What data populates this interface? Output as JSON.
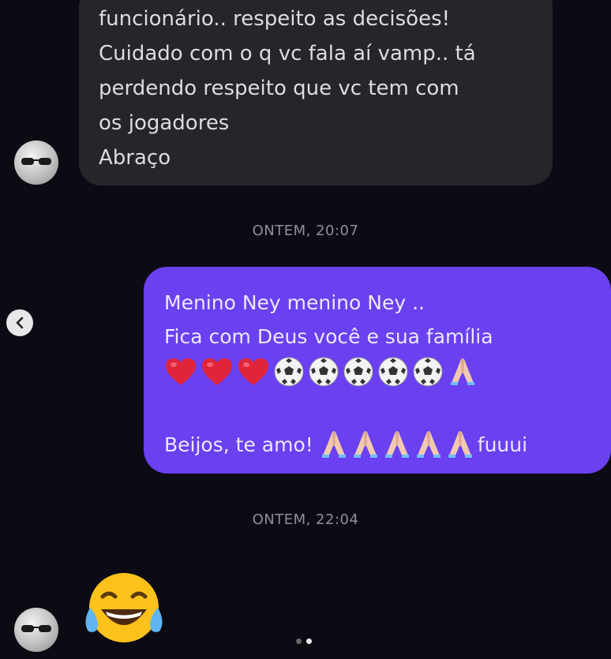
{
  "incoming_message": {
    "lines": [
      "funcionário.. respeito as decisões!",
      "Cuidado com o q vc fala aí vamp.. tá",
      "perdendo respeito que vc tem com",
      "os jogadores",
      "Abraço"
    ]
  },
  "timestamps": [
    "ONTEM, 20:07",
    "ONTEM, 22:04"
  ],
  "outgoing_message": {
    "line1": "Menino Ney menino Ney ..",
    "line2": "Fica com Deus você e sua família",
    "emojis": [
      "heart-emoji",
      "heart-emoji",
      "heart-emoji",
      "soccer-ball-emoji",
      "soccer-ball-emoji",
      "soccer-ball-emoji",
      "soccer-ball-emoji",
      "soccer-ball-emoji",
      "praying-hands-emoji"
    ],
    "kiss_text": "Beijos, te amo!",
    "kiss_emojis": [
      "praying-hands-emoji",
      "praying-hands-emoji",
      "praying-hands-emoji",
      "praying-hands-emoji",
      "praying-hands-emoji"
    ],
    "end_text": "fuuui"
  },
  "reaction_emoji": "tears-of-joy-emoji",
  "pagination": {
    "total": 2,
    "active": 2
  },
  "colors": {
    "background": "#0c0b14",
    "incoming_bubble": "#26252c",
    "outgoing_bubble": "#6a40f0"
  }
}
